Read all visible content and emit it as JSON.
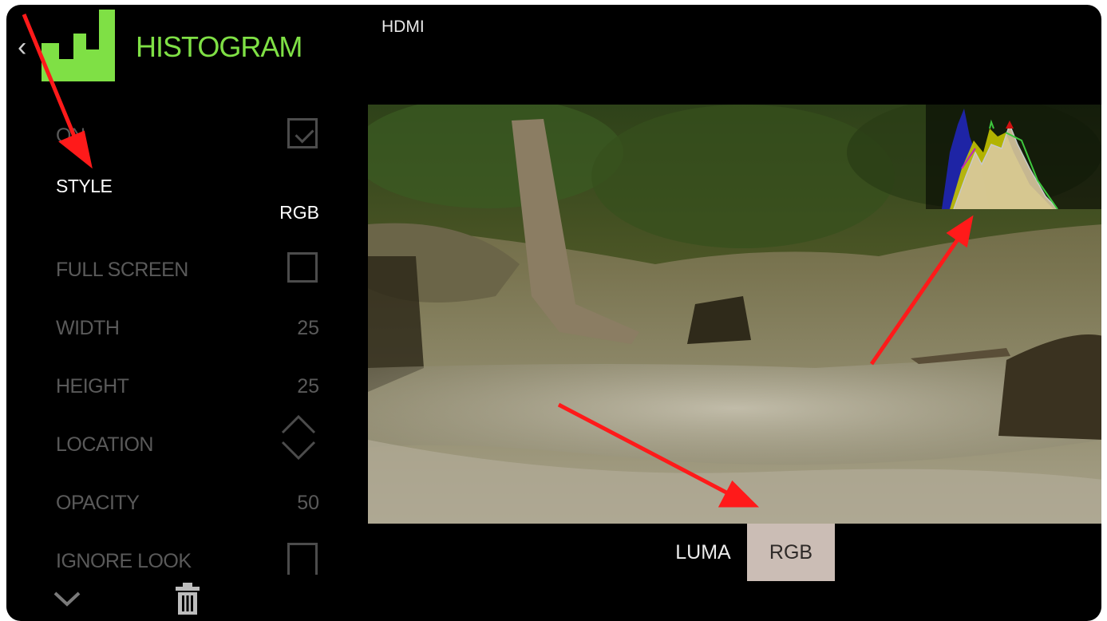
{
  "header": {
    "back_icon": "chevron-left-icon",
    "logo_icon": "histogram-logo-icon",
    "title": "HISTOGRAM",
    "source": "HDMI"
  },
  "menu": {
    "on_label": "ON",
    "on_checked": true,
    "style_label": "STYLE",
    "style_value": "RGB",
    "full_screen_label": "FULL SCREEN",
    "full_screen_checked": false,
    "width_label": "WIDTH",
    "width_value": "25",
    "height_label": "HEIGHT",
    "height_value": "25",
    "location_label": "LOCATION",
    "location_icon": "move-diamond-icon",
    "opacity_label": "OPACITY",
    "opacity_value": "50",
    "ignore_look_label": "IGNORE LOOK",
    "ignore_look_checked": false
  },
  "footer": {
    "collapse_icon": "chevron-down-icon",
    "delete_icon": "trash-icon"
  },
  "style_selector": {
    "options": [
      "LUMA",
      "RGB"
    ],
    "selected": "RGB"
  },
  "colors": {
    "accent_green": "#7fe045",
    "selected_segment": "#cbbdb5",
    "annotation_arrow": "#ff1a1a",
    "inactive_text": "#5a5a5a"
  }
}
